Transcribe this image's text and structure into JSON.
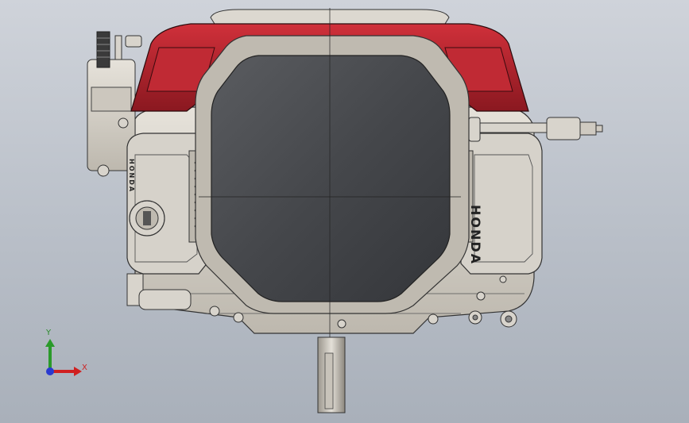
{
  "viewport": {
    "background_top": "#cfd3da",
    "background_bottom": "#a9b0ba"
  },
  "model": {
    "name": "engine-assembly",
    "shroud_color": "#b0202a",
    "body_color": "#d8d4cc",
    "cover_color": "#4a4c50",
    "brand_right": "HONDA",
    "brand_left": "HONDA"
  },
  "triad": {
    "y_label": "Y",
    "x_label": "X",
    "y_color": "#2a9a2a",
    "x_color": "#d02020",
    "z_color": "#2a3ad0"
  }
}
